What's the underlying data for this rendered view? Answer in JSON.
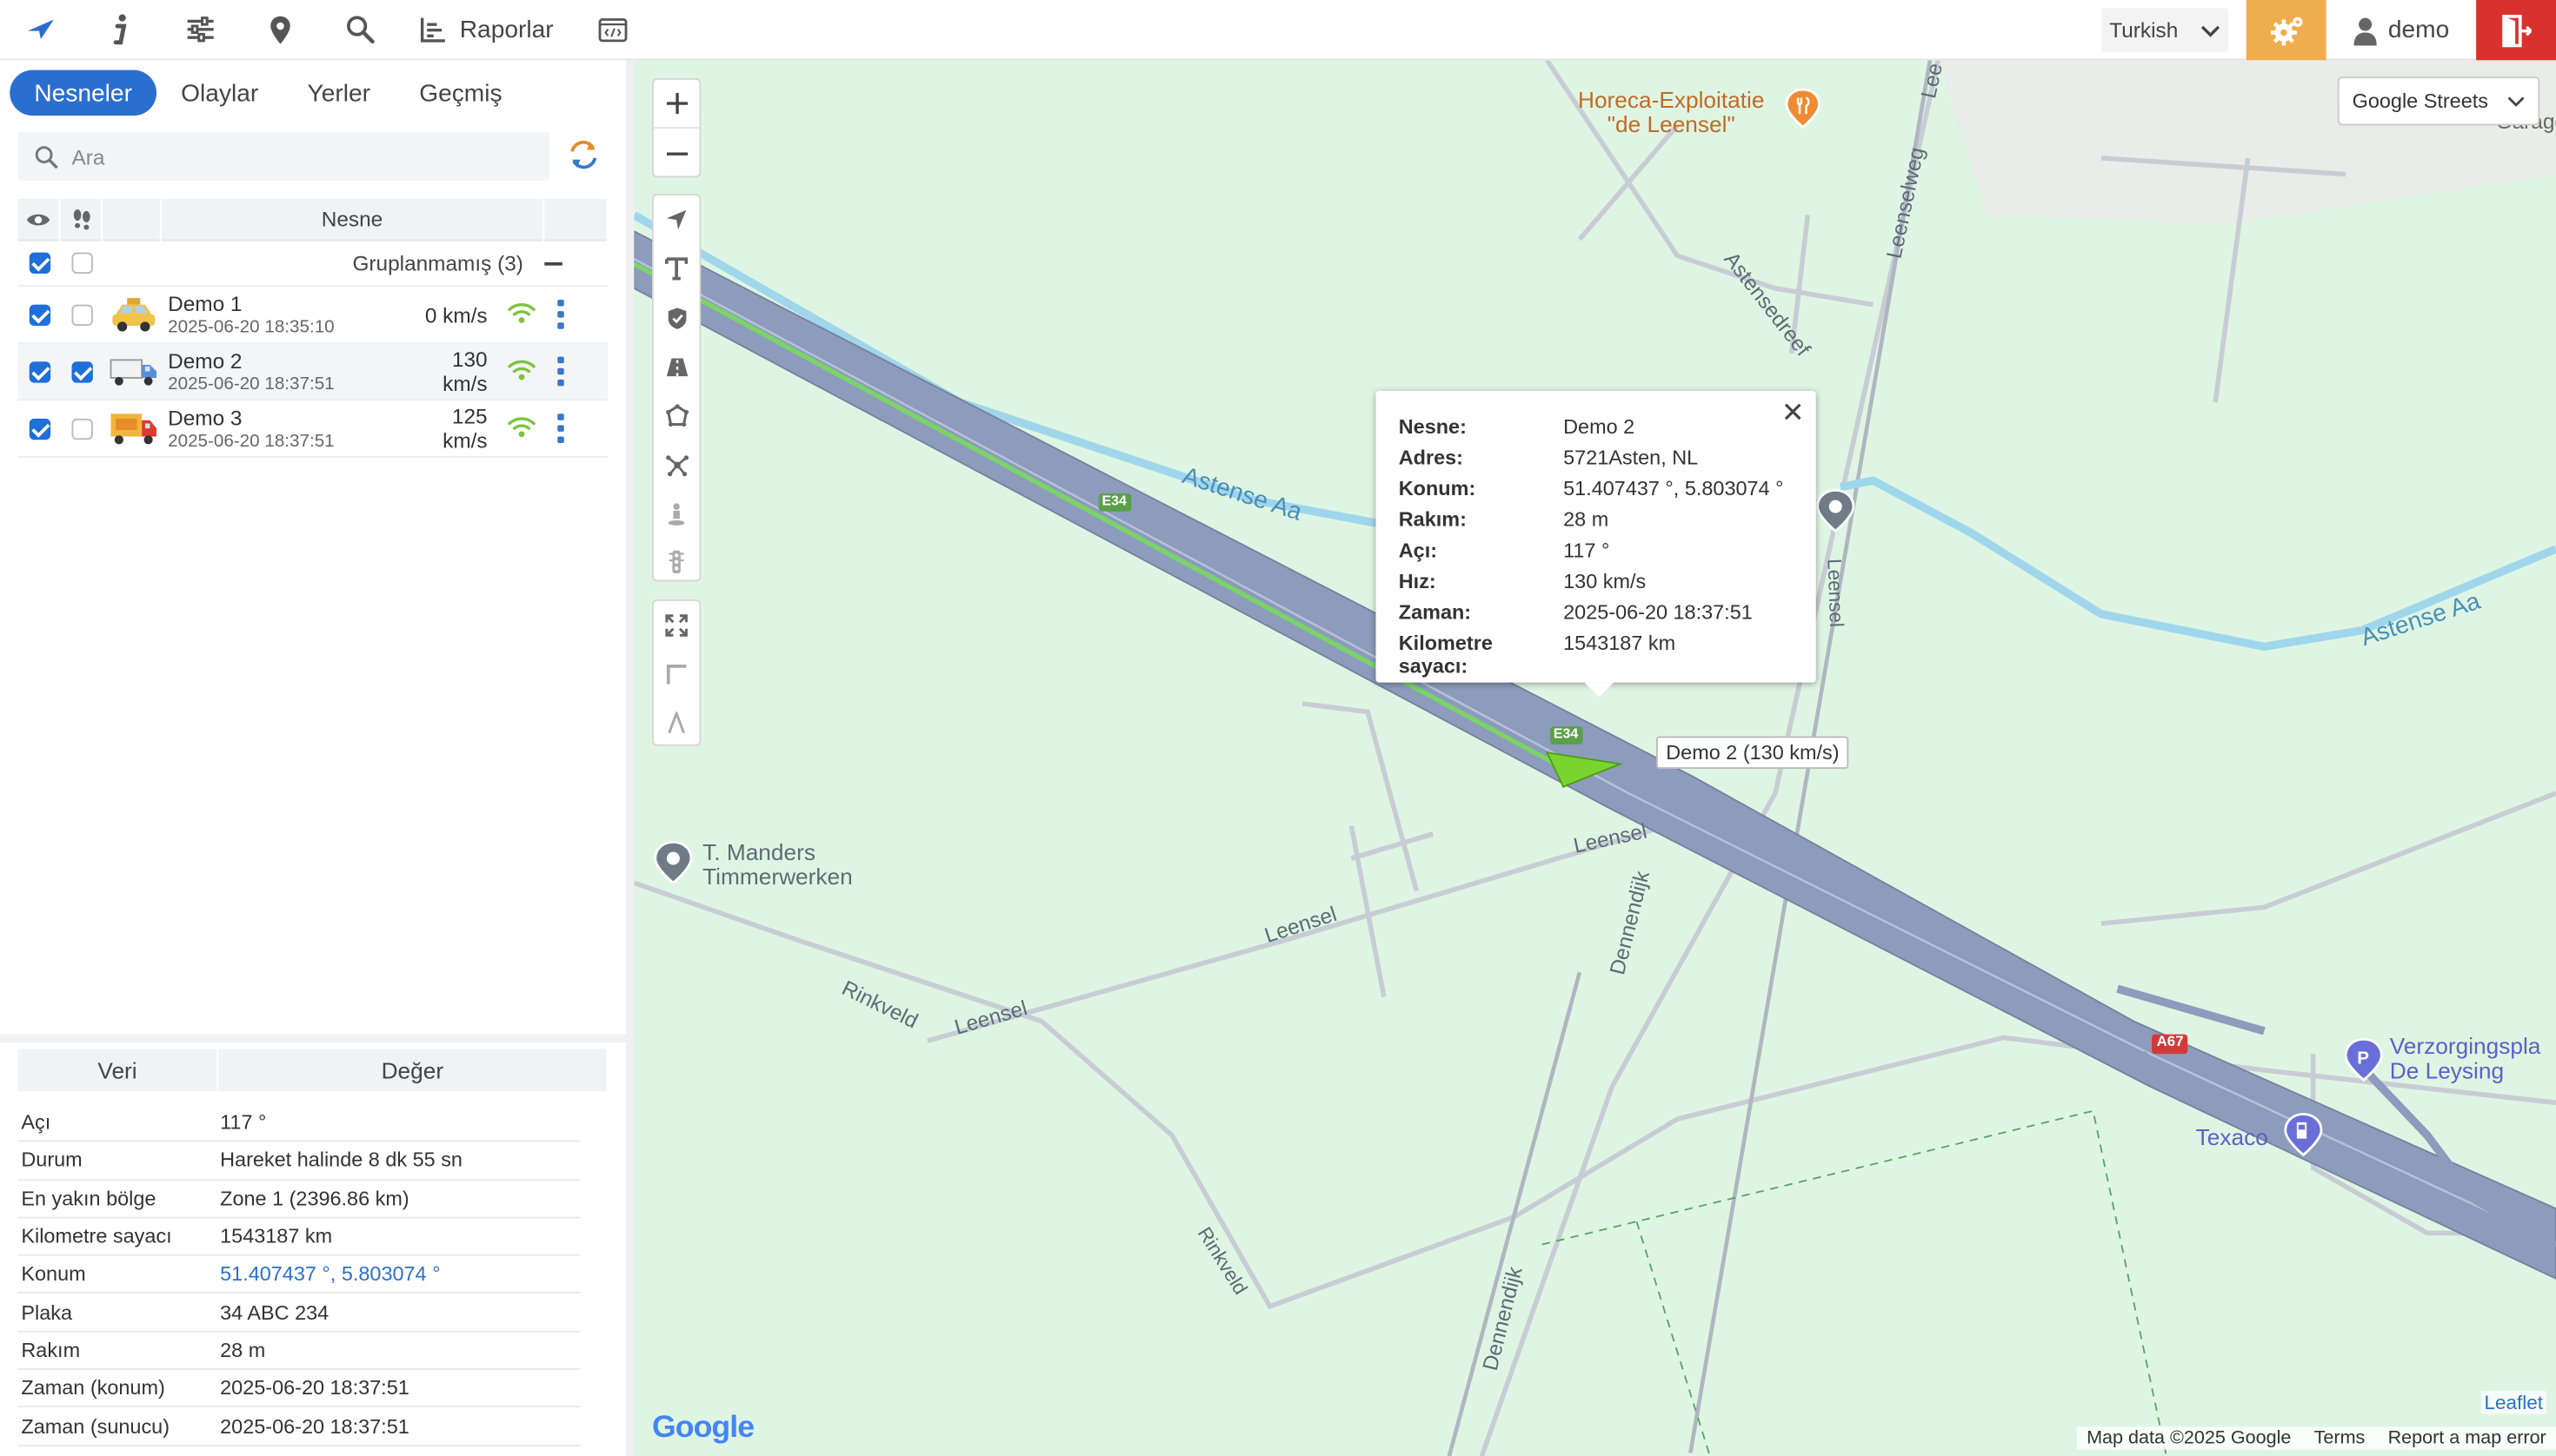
{
  "topbar": {
    "reports_label": "Raporlar",
    "language": "Turkish",
    "user": "demo"
  },
  "tabs": [
    "Nesneler",
    "Olaylar",
    "Yerler",
    "Geçmiş"
  ],
  "search": {
    "placeholder": "Ara"
  },
  "objects": {
    "header": "Nesne",
    "group_label": "Gruplanmamış (3)",
    "rows": [
      {
        "name": "Demo 1",
        "time": "2025-06-20 18:35:10",
        "speed": "0 km/s",
        "visible": true,
        "follow": false,
        "icon": "taxi-icon"
      },
      {
        "name": "Demo 2",
        "time": "2025-06-20 18:37:51",
        "speed": "130 km/s",
        "visible": true,
        "follow": true,
        "icon": "truck-icon"
      },
      {
        "name": "Demo 3",
        "time": "2025-06-20 18:37:51",
        "speed": "125 km/s",
        "visible": true,
        "follow": false,
        "icon": "delivery-truck-icon"
      }
    ]
  },
  "details": {
    "headers": [
      "Veri",
      "Değer"
    ],
    "rows": [
      {
        "k": "Açı",
        "v": "117 °"
      },
      {
        "k": "Durum",
        "v": "Hareket halinde 8 dk 55 sn"
      },
      {
        "k": "En yakın bölge",
        "v": "Zone 1 (2396.86 km)"
      },
      {
        "k": "Kilometre sayacı",
        "v": "1543187 km"
      },
      {
        "k": "Konum",
        "v": "51.407437 °, 5.803074 °"
      },
      {
        "k": "Plaka",
        "v": "34 ABC 234"
      },
      {
        "k": "Rakım",
        "v": "28 m"
      },
      {
        "k": "Zaman (konum)",
        "v": "2025-06-20 18:37:51"
      },
      {
        "k": "Zaman (sunucu)",
        "v": "2025-06-20 18:37:51"
      }
    ]
  },
  "map": {
    "layer": "Google Streets",
    "popup": {
      "rows": [
        {
          "k": "Nesne:",
          "v": "Demo 2"
        },
        {
          "k": "Adres:",
          "v": "5721Asten, NL"
        },
        {
          "k": "Konum:",
          "v": "51.407437 °, 5.803074 °"
        },
        {
          "k": "Rakım:",
          "v": "28 m"
        },
        {
          "k": "Açı:",
          "v": "117 °"
        },
        {
          "k": "Hız:",
          "v": "130 km/s"
        },
        {
          "k": "Zaman:",
          "v": "2025-06-20 18:37:51"
        },
        {
          "k": "Kilometre sayacı:",
          "v": "1543187 km"
        }
      ]
    },
    "vehicle_label": "Demo 2 (130 km/s)",
    "labels": {
      "poi1_line1": "Horeca-Exploitatie",
      "poi1_line2": "\"de Leensel\"",
      "poi2_line1": "T. Manders",
      "poi2_line2": "Timmerwerken",
      "poi3_line1": "Verzorgingspla",
      "poi3_line2": "De Leysing",
      "texaco": "Texaco",
      "astense_aa": "Astense Aa",
      "astense_aa2": "Astense Aa",
      "astensedreef": "Astensedreef",
      "leenselweg": "Leenselweg",
      "leensel1": "Leensel",
      "leensel2": "Leensel",
      "leensel3": "Leensel",
      "leensel4": "Leensel",
      "rinkveld1": "Rinkveld",
      "rinkveld2": "Rinkveld",
      "dennendijk1": "Dennendijk",
      "dennendijk2": "Dennendijk",
      "e34a": "E34",
      "e34b": "E34",
      "a67": "A67",
      "garage": "Garage Swin",
      "leenselweg_top": "Lee"
    },
    "attribution": {
      "map_data": "Map data ©2025 Google",
      "terms": "Terms",
      "report": "Report a map error",
      "leaflet": "Leaflet",
      "google": "Google"
    }
  },
  "colors": {
    "primary": "#2a6fcf",
    "settings_bg": "#f0ad4e",
    "logout_bg": "#d9322e",
    "map_bg": "#dff5e3",
    "motorway": "#8d9bbd",
    "water": "#9fd6ec"
  }
}
